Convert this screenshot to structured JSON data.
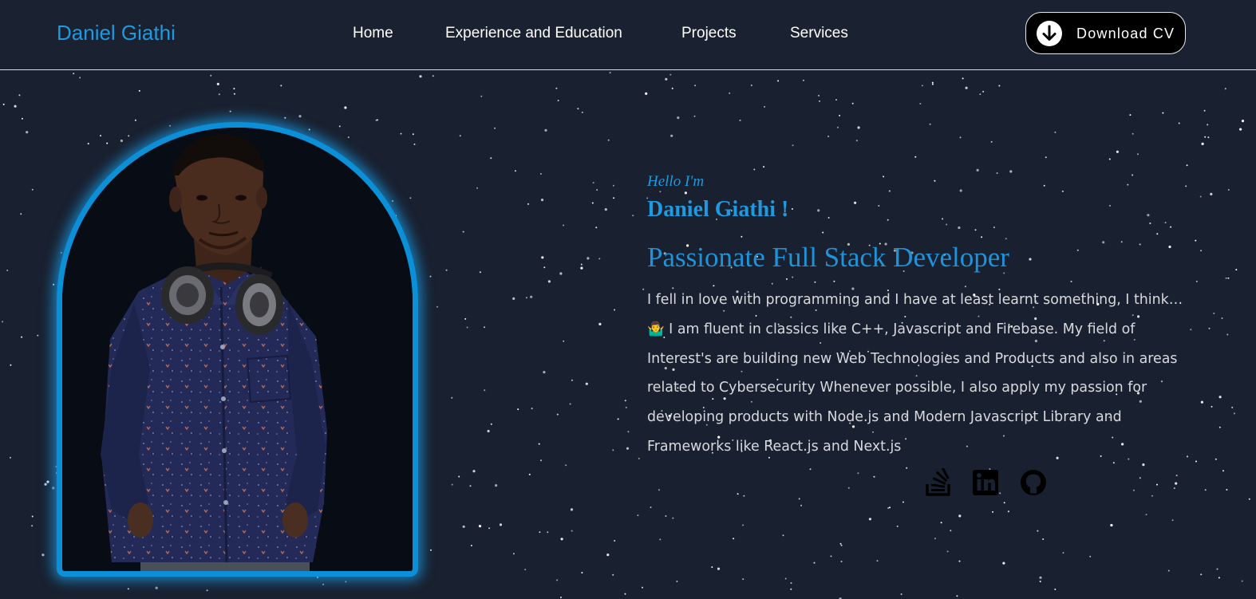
{
  "header": {
    "brand": "Daniel Giathi",
    "nav": [
      {
        "label": "Home"
      },
      {
        "label": "Experience and Education"
      },
      {
        "label": "Projects"
      },
      {
        "label": "Services"
      }
    ],
    "download_cv": {
      "label": "Download CV",
      "icon": "download-arrow-icon"
    }
  },
  "hero": {
    "greeting": "Hello I'm",
    "name": "Daniel Giathi !",
    "role": "Passionate Full Stack Developer",
    "bio": "I fell in love with programming and I have at least learnt something, I think… 🤷‍♂️ I am fluent in classics like C++, Javascript and Firebase. My field of Interest's are building new Web Technologies and Products and also in areas related to Cybersecurity Whenever possible, I also apply my passion for developing products with Node.js and Modern Javascript Library and Frameworks like React.js and Next.js",
    "socials": [
      {
        "icon": "stack-overflow-icon"
      },
      {
        "icon": "linkedin-icon"
      },
      {
        "icon": "github-icon"
      }
    ]
  },
  "colors": {
    "accent": "#1e9ae0",
    "background": "#19202f",
    "frame_glow": "#0b8fd6",
    "text": "#d8d9dd"
  }
}
